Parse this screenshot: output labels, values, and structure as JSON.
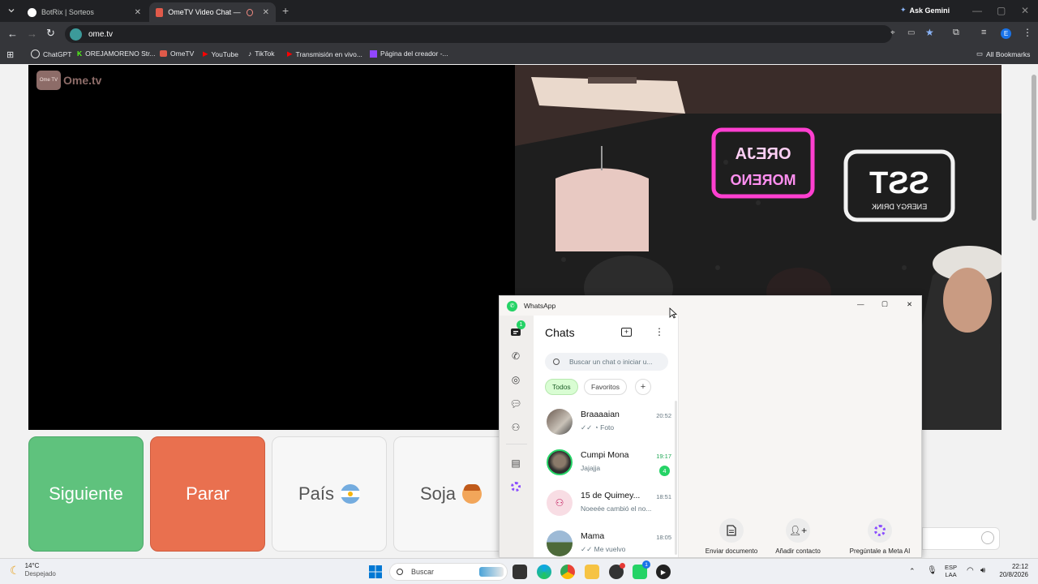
{
  "browser": {
    "tabs": [
      {
        "label": "BotRix | Sorteos",
        "active": false
      },
      {
        "label": "OmeTV Video Chat — Alte",
        "active": true
      }
    ],
    "ask_gemini": "Ask Gemini",
    "url": "ome.tv",
    "profile_initial": "E",
    "bookmarks": [
      "ChatGPT",
      "OREJAMORENO Str...",
      "OmeTV",
      "YouTube",
      "TikTok",
      "Transmisión en vivo...",
      "Página del creador -..."
    ],
    "all_bookmarks": "All Bookmarks"
  },
  "page": {
    "logo_text": "Ome.tv",
    "logo_badge": "Ome TV",
    "buttons": {
      "next": "Siguiente",
      "stop": "Parar",
      "country": "País",
      "gender": "Soja"
    },
    "neon_left": [
      "OREJA",
      "MORENO"
    ],
    "neon_right_big": "SST",
    "neon_right_small": "ENERGY DRINK"
  },
  "whatsapp": {
    "app_title": "WhatsApp",
    "chats_title": "Chats",
    "chats_badge": "1",
    "search_placeholder": "Buscar un chat o iniciar u...",
    "filters": {
      "all": "Todos",
      "favorites": "Favoritos"
    },
    "chats": [
      {
        "name": "Braaaaian",
        "message": "Foto",
        "time": "20:52"
      },
      {
        "name": "Cumpi Mona",
        "message": "Jajajja",
        "time": "19:17",
        "unread": "4"
      },
      {
        "name": "15 de Quimey...",
        "message": "Noeeée cambió el no...",
        "time": "18:51"
      },
      {
        "name": "Mama",
        "message": "Me vuelvo",
        "time": "18:05"
      }
    ],
    "actions": {
      "document": "Enviar documento",
      "contact": "Añadir contacto",
      "meta_ai": "Pregúntale a Meta AI"
    }
  },
  "taskbar": {
    "temperature": "14°C",
    "weather": "Despejado",
    "search": "Buscar",
    "lang1": "ESP",
    "lang2": "LAA",
    "time": "22:12",
    "date": "20/8/2026",
    "whatsapp_badge": "1"
  },
  "colors": {
    "next": "#5fc27d",
    "stop": "#e9704f",
    "whatsapp": "#25d366",
    "neon_pink": "#ff3fd0"
  }
}
